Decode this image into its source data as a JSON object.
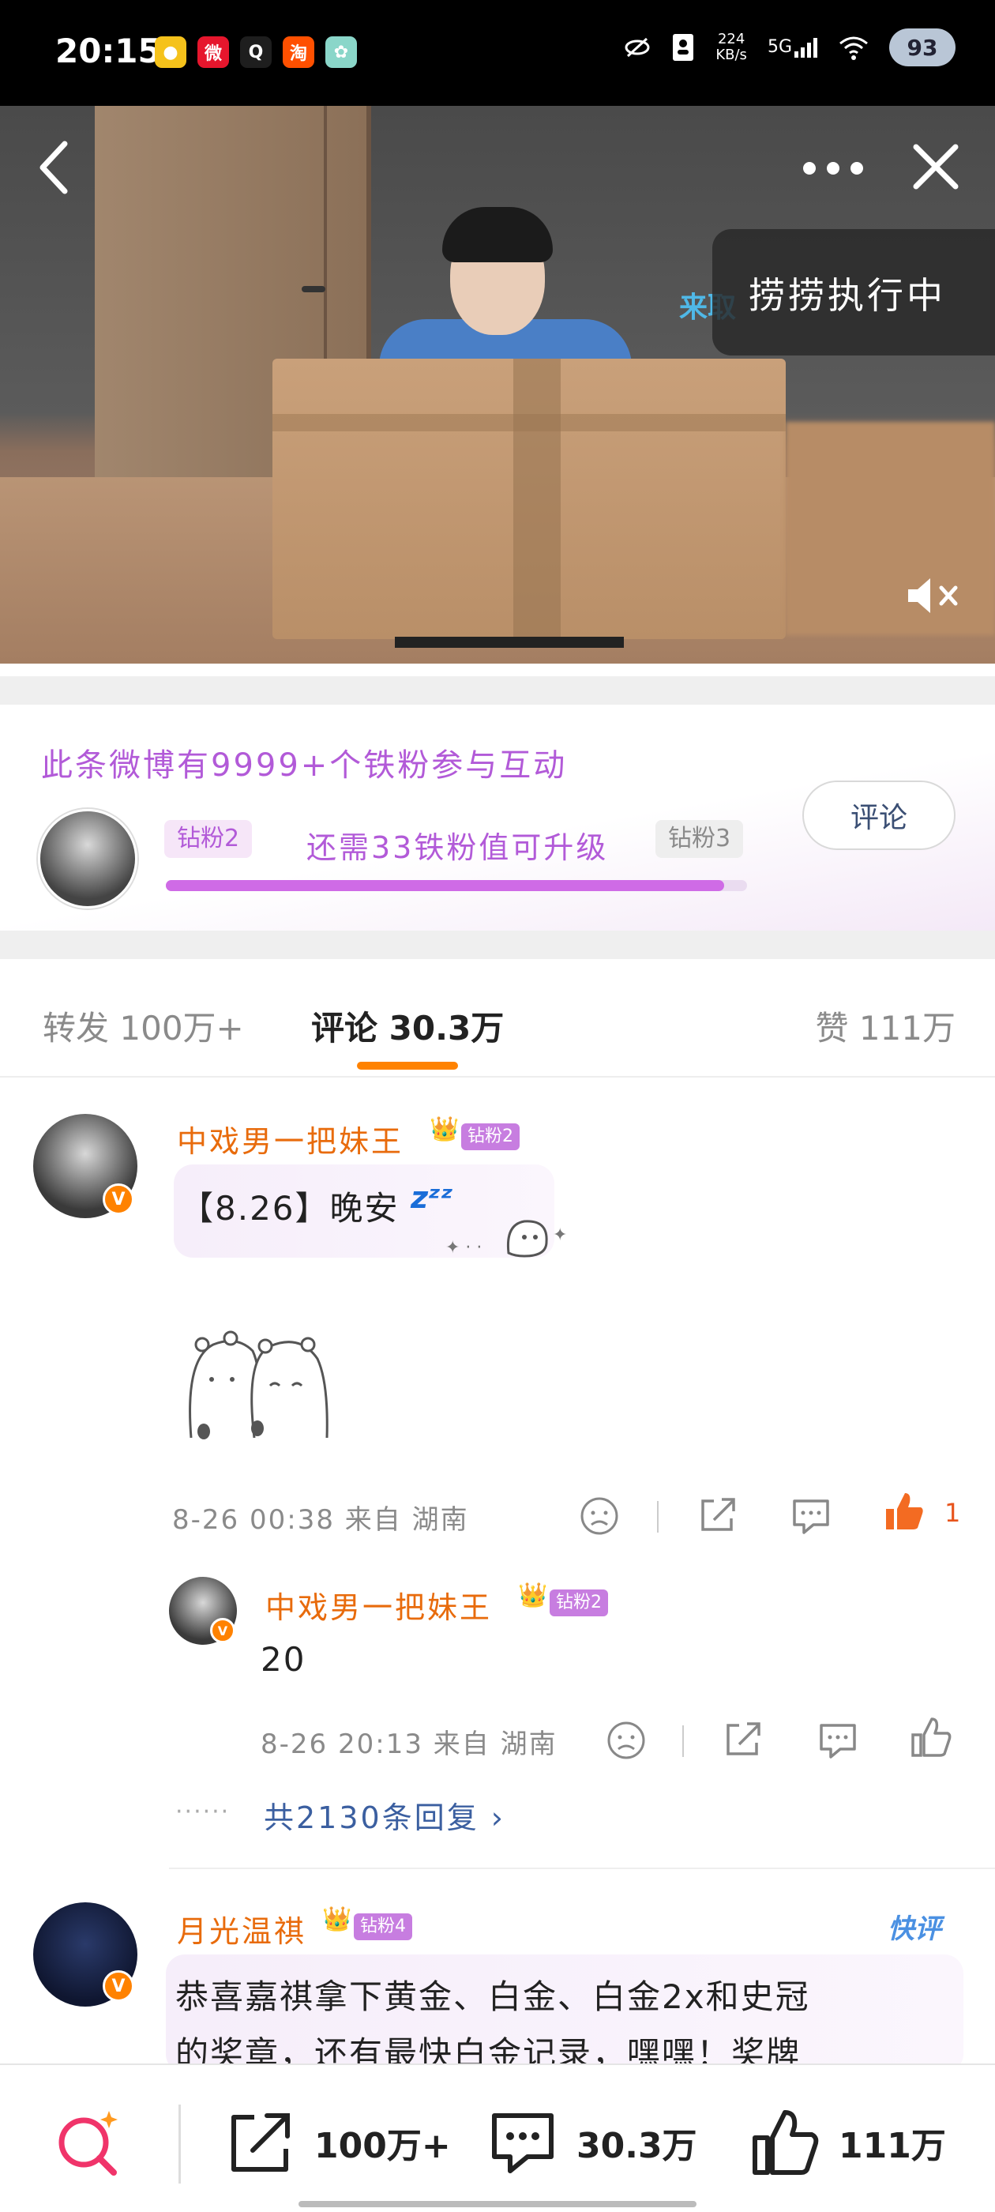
{
  "status_bar": {
    "time": "20:15",
    "net_speed_value": "224",
    "net_speed_unit": "KB/s",
    "network": "5G",
    "battery": "93",
    "app_icons": [
      {
        "name": "fruit-app-icon",
        "glyph": "●",
        "color": "#f5c21b"
      },
      {
        "name": "weibo-icon",
        "glyph": "微",
        "color": "#e6162d"
      },
      {
        "name": "qq-icon",
        "glyph": "Q",
        "color": "#1e1e1e"
      },
      {
        "name": "taobao-icon",
        "glyph": "淘",
        "color": "#ff5000"
      },
      {
        "name": "gallery-app-icon",
        "glyph": "✿",
        "color": "#8ad6c9"
      }
    ]
  },
  "video": {
    "toast_text": "捞捞执行中",
    "caption_fragment": "来取"
  },
  "fan_panel": {
    "title": "此条微博有9999+个铁粉参与互动",
    "current_level": "钻粉2",
    "next_level": "钻粉3",
    "need_text": "还需33铁粉值可升级",
    "progress": 0.96,
    "comment_button": "评论"
  },
  "tabs": {
    "repost_label": "转发",
    "repost_count": "100万+",
    "comment_label": "评论",
    "comment_count": "30.3万",
    "like_label": "赞",
    "like_count": "111万"
  },
  "comments": [
    {
      "user": "中戏男一把妹王",
      "badge": "钻粉2",
      "text": "【8.26】晚安",
      "time": "8-26 00:38",
      "location": "来自 湖南",
      "likes": "1",
      "reply": {
        "user": "中戏男一把妹王",
        "badge": "钻粉2",
        "text": "20",
        "time": "8-26 20:13",
        "location": "来自 湖南"
      },
      "reply_link": "共2130条回复 ›"
    },
    {
      "user": "月光温祺",
      "badge": "钻粉4",
      "tag": "快评",
      "text_line1": "恭喜嘉祺拿下黄金、白金、白金2x和史冠",
      "text_line2": "的奖章，还有最快白金记录，嘿嘿！奖牌"
    }
  ],
  "bottom_bar": {
    "repost_count": "100万+",
    "comment_count": "30.3万",
    "like_count": "111万"
  },
  "colors": {
    "accent_orange": "#ff8200",
    "fan_purple": "#b25ad8",
    "name_orange": "#e86b0c",
    "link_blue": "#3b5fa0"
  }
}
